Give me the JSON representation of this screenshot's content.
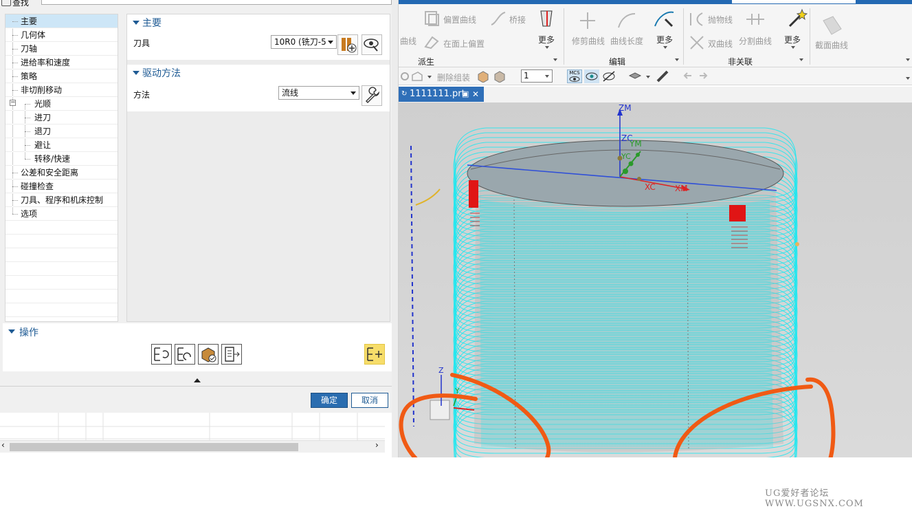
{
  "search": {
    "label": "查找"
  },
  "tree": {
    "items": [
      {
        "label": "主要",
        "indent": 0
      },
      {
        "label": "几何体",
        "indent": 0
      },
      {
        "label": "刀轴",
        "indent": 0
      },
      {
        "label": "进给率和速度",
        "indent": 0
      },
      {
        "label": "策略",
        "indent": 0
      },
      {
        "label": "非切削移动",
        "indent": 0
      },
      {
        "label": "光顺",
        "indent": 1
      },
      {
        "label": "进刀",
        "indent": 1
      },
      {
        "label": "退刀",
        "indent": 1
      },
      {
        "label": "避让",
        "indent": 1
      },
      {
        "label": "转移/快速",
        "indent": 1
      },
      {
        "label": "公差和安全距离",
        "indent": 0
      },
      {
        "label": "碰撞检查",
        "indent": 0
      },
      {
        "label": "刀具、程序和机床控制",
        "indent": 0
      },
      {
        "label": "选项",
        "indent": 0
      }
    ]
  },
  "main_group": {
    "title": "主要",
    "tool_label": "刀具",
    "tool_value": "10R0 (铣刀-5"
  },
  "drive_group": {
    "title": "驱动方法",
    "method_label": "方法",
    "method_value": "流线"
  },
  "operations": {
    "title": "操作"
  },
  "buttons": {
    "ok": "确定",
    "cancel": "取消"
  },
  "ribbon": {
    "items": {
      "curve": "曲线",
      "offset_curve": "偏置曲线",
      "bridge": "桥接",
      "more": "更多",
      "offset_on_face": "在面上偏置",
      "trim_curve": "修剪曲线",
      "curve_length": "曲线长度",
      "parabola": "抛物线",
      "hyperbola": "双曲线",
      "split_curve": "分割曲线",
      "section_curve": "截面曲线"
    },
    "groups": {
      "derived": "派生",
      "edit": "编辑",
      "nonassoc": "非关联"
    },
    "toolbar2": {
      "delete_group": "删除组装",
      "layer_value": "1",
      "mcs": "MCS"
    }
  },
  "tab": {
    "title": "1111111.prt"
  },
  "viewport": {
    "axes": {
      "zm": "ZM",
      "zc": "ZC",
      "ym": "YM",
      "yc": "YC",
      "xc": "XC",
      "xm": "XM",
      "z": "Z",
      "y": "Y"
    }
  },
  "watermark": "UG爱好者论坛 WWW.UGSNX.COM",
  "colors": {
    "accent": "#1f5b94",
    "toolpath": "#1fe8f0",
    "annotation": "#f05a14",
    "ok": "#2a6db0"
  }
}
